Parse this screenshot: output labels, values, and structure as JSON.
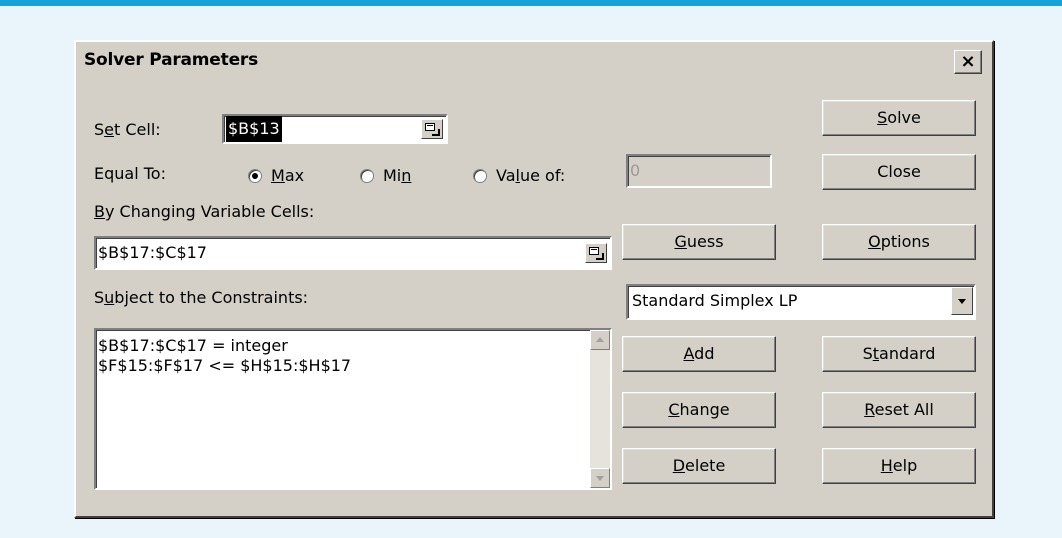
{
  "dialog": {
    "title": "Solver Parameters",
    "close_glyph": "×"
  },
  "set_cell": {
    "label_pre": "S",
    "label_mnemonic": "e",
    "label_post": "t Cell:",
    "value": "$B$13"
  },
  "equal_to": {
    "label": "Equal To:",
    "options": [
      {
        "pre": "",
        "mnemonic": "M",
        "post": "ax",
        "checked": true
      },
      {
        "pre": "Mi",
        "mnemonic": "n",
        "post": "",
        "checked": false
      },
      {
        "pre": "Va",
        "mnemonic": "l",
        "post": "ue of:",
        "checked": false
      }
    ],
    "value_of": "0"
  },
  "changing_cells": {
    "label_mnemonic": "B",
    "label_post": "y Changing Variable Cells:",
    "value": "$B$17:$C$17"
  },
  "constraints": {
    "label_pre": "S",
    "label_mnemonic": "u",
    "label_post": "bject to the Constraints:",
    "items": [
      "$B$17:$C$17 = integer",
      "$F$15:$F$17 <= $H$15:$H$17"
    ]
  },
  "method": {
    "selected": "Standard Simplex LP"
  },
  "buttons": {
    "solve": {
      "pre": "",
      "mnemonic": "S",
      "post": "olve"
    },
    "close": {
      "pre": "Close",
      "mnemonic": "",
      "post": ""
    },
    "guess": {
      "pre": "",
      "mnemonic": "G",
      "post": "uess"
    },
    "options": {
      "pre": "",
      "mnemonic": "O",
      "post": "ptions"
    },
    "add": {
      "pre": "",
      "mnemonic": "A",
      "post": "dd"
    },
    "standard": {
      "pre": "S",
      "mnemonic": "t",
      "post": "andard"
    },
    "change": {
      "pre": "",
      "mnemonic": "C",
      "post": "hange"
    },
    "reset_all": {
      "pre": "",
      "mnemonic": "R",
      "post": "eset All"
    },
    "delete": {
      "pre": "",
      "mnemonic": "D",
      "post": "elete"
    },
    "help": {
      "pre": "",
      "mnemonic": "H",
      "post": "elp"
    }
  }
}
